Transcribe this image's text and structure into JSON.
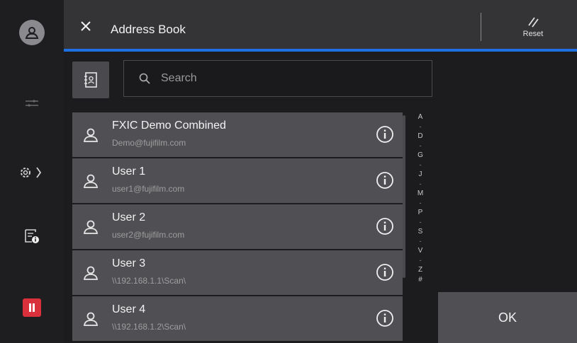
{
  "header": {
    "title": "Address Book",
    "reset_label": "Reset"
  },
  "search": {
    "placeholder": "Search"
  },
  "contacts": [
    {
      "name": "FXIC Demo Combined",
      "detail": "Demo@fujifilm.com"
    },
    {
      "name": "User 1",
      "detail": "user1@fujifilm.com"
    },
    {
      "name": "User 2",
      "detail": "user2@fujifilm.com"
    },
    {
      "name": "User 3",
      "detail": "\\\\192.168.1.1\\Scan\\"
    },
    {
      "name": "User 4",
      "detail": "\\\\192.168.1.2\\Scan\\"
    }
  ],
  "index_letters": [
    "A",
    "·",
    "D",
    "·",
    "G",
    "·",
    "J",
    "·",
    "M",
    "·",
    "P",
    "·",
    "S",
    "·",
    "V",
    "·",
    "Z",
    "#"
  ],
  "ok_label": "OK",
  "colors": {
    "accent": "#1e6fe0",
    "pause": "#d9303b"
  }
}
